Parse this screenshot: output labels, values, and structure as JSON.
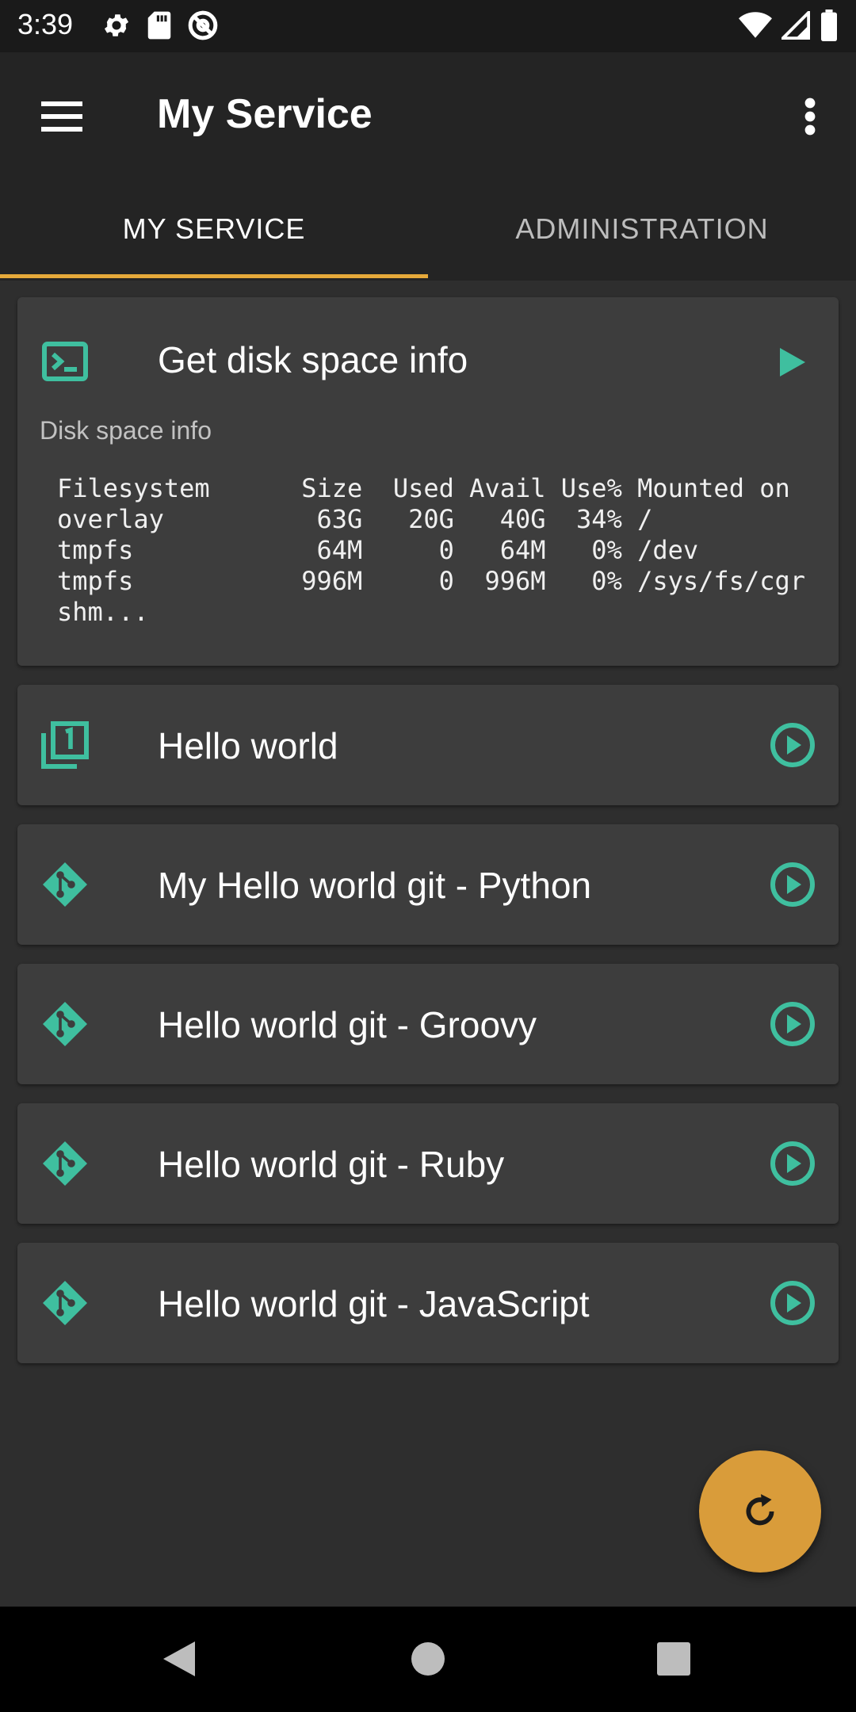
{
  "status_bar": {
    "time": "3:39",
    "left_icons": [
      "gear-icon",
      "sd-card-icon",
      "at-sign-icon"
    ],
    "right_icons": [
      "wifi-icon",
      "cell-signal-icon",
      "battery-icon"
    ]
  },
  "app_bar": {
    "title": "My Service",
    "menu_icon": "hamburger-menu-icon",
    "overflow_icon": "more-vertical-icon"
  },
  "tabs": [
    {
      "label": "MY SERVICE",
      "active": true
    },
    {
      "label": "ADMINISTRATION",
      "active": false
    }
  ],
  "scripts": [
    {
      "title": "Get disk space info",
      "icon": "terminal-icon",
      "action_icon": "play-filled-icon",
      "subtitle": "Disk space info",
      "output": "Filesystem      Size  Used Avail Use% Mounted on\noverlay          63G   20G   40G  34% /\ntmpfs            64M     0   64M   0% /dev\ntmpfs           996M     0  996M   0% /sys/fs/cgr\nshm..."
    },
    {
      "title": "Hello world",
      "icon": "script-one-icon",
      "action_icon": "play-circle-icon"
    },
    {
      "title": "My Hello world git - Python",
      "icon": "git-icon",
      "action_icon": "play-circle-icon"
    },
    {
      "title": "Hello world git - Groovy",
      "icon": "git-icon",
      "action_icon": "play-circle-icon"
    },
    {
      "title": "Hello world git - Ruby",
      "icon": "git-icon",
      "action_icon": "play-circle-icon"
    },
    {
      "title": "Hello world git - JavaScript",
      "icon": "git-icon",
      "action_icon": "play-circle-icon"
    }
  ],
  "fab": {
    "icon": "refresh-icon"
  },
  "nav_bar": {
    "icons": [
      "back-icon",
      "home-icon",
      "recents-icon"
    ]
  },
  "colors": {
    "accent": "#e6a93a",
    "fab": "#d99c3a",
    "icon_teal": "#3fbf9f",
    "card": "#3d3d3d",
    "background": "#2e2e2e",
    "app_bar": "#242424"
  }
}
